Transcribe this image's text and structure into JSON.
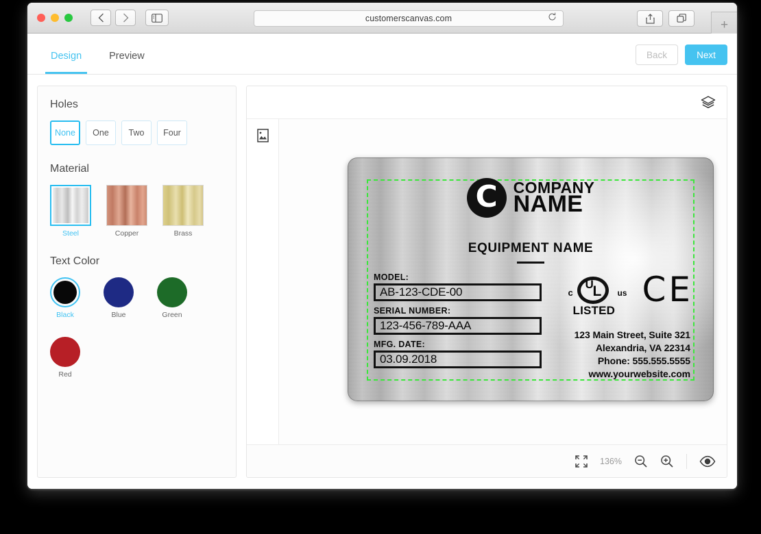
{
  "browser": {
    "url": "customerscanvas.com",
    "back_icon": "chevron-left-icon",
    "forward_icon": "chevron-right-icon",
    "sidebar_icon": "sidebar-toggle-icon",
    "reload_icon": "reload-icon",
    "share_icon": "share-icon",
    "tabs_icon": "show-tabs-icon",
    "new_tab_label": "+"
  },
  "header": {
    "tabs": [
      {
        "label": "Design",
        "active": true
      },
      {
        "label": "Preview",
        "active": false
      }
    ],
    "back_label": "Back",
    "next_label": "Next",
    "accent_color": "#45c3f0"
  },
  "options": {
    "holes": {
      "title": "Holes",
      "items": [
        {
          "label": "None",
          "selected": true
        },
        {
          "label": "One",
          "selected": false
        },
        {
          "label": "Two",
          "selected": false
        },
        {
          "label": "Four",
          "selected": false
        }
      ]
    },
    "material": {
      "title": "Material",
      "items": [
        {
          "label": "Steel",
          "selected": true,
          "swatch": "steel-grad"
        },
        {
          "label": "Copper",
          "selected": false,
          "swatch": "copper-grad"
        },
        {
          "label": "Brass",
          "selected": false,
          "swatch": "brass-grad"
        }
      ]
    },
    "text_color": {
      "title": "Text Color",
      "items": [
        {
          "label": "Black",
          "color": "#080808",
          "selected": true
        },
        {
          "label": "Blue",
          "color": "#1e2a84",
          "selected": false
        },
        {
          "label": "Green",
          "color": "#1d6b28",
          "selected": false
        },
        {
          "label": "Red",
          "color": "#b71f26",
          "selected": false
        }
      ]
    }
  },
  "canvas": {
    "layers_icon": "layers-icon",
    "image_tool_icon": "image-icon",
    "fit_icon": "fit-to-screen-icon",
    "zoom_level": "136%",
    "zoom_out_icon": "zoom-out-icon",
    "zoom_in_icon": "zoom-in-icon",
    "preview_icon": "eye-icon"
  },
  "nameplate": {
    "logo": {
      "mark_letter": "C",
      "line1": "COMPANY",
      "line2": "NAME"
    },
    "equipment_name": "EQUIPMENT NAME",
    "fields": [
      {
        "label": "MODEL:",
        "value": "AB-123-CDE-00"
      },
      {
        "label": "SERIAL NUMBER:",
        "value": "123-456-789-AAA"
      },
      {
        "label": "MFG. DATE:",
        "value": "03.09.2018"
      }
    ],
    "ul_mark": {
      "prefix": "c",
      "suffix": "us",
      "letter_u": "U",
      "letter_l": "L",
      "listed": "LISTED"
    },
    "ce_mark": {
      "c": "C",
      "e": "E"
    },
    "address": [
      "123 Main Street, Suite 321",
      "Alexandria, VA 22314",
      "Phone: 555.555.5555",
      "www.yourwebsite.com"
    ],
    "safe_area_color": "#3ce63c"
  }
}
